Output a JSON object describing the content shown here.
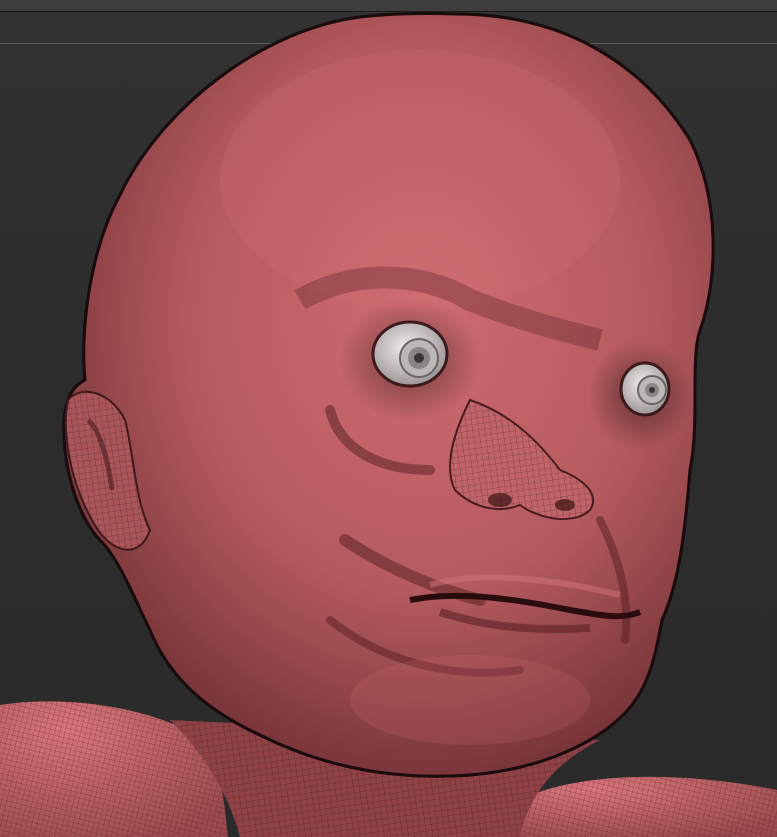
{
  "app": {
    "name": ""
  },
  "viewport": {
    "background_color": "#2b2b2b",
    "subject": {
      "icon": "sculpted-head-mesh-icon",
      "material_color": "#b45a5e",
      "wire_color": "#3a1719"
    }
  }
}
